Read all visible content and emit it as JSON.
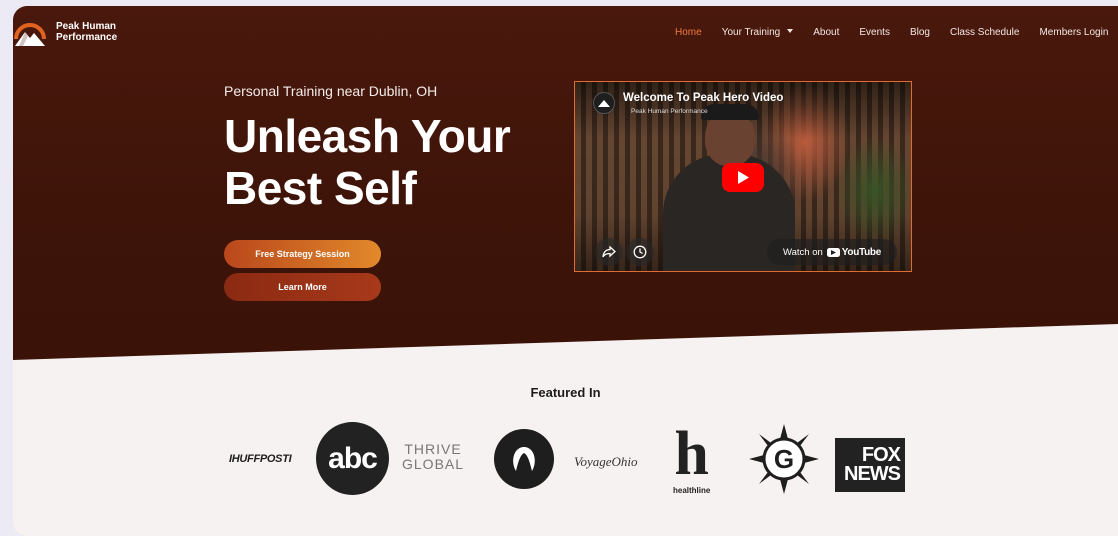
{
  "brand": {
    "name_line1": "Peak Human",
    "name_line2": "Performance",
    "accent": "#e2631f"
  },
  "nav": {
    "items": [
      {
        "label": "Home",
        "active": true
      },
      {
        "label": "Your Training",
        "dropdown": true
      },
      {
        "label": "About"
      },
      {
        "label": "Events"
      },
      {
        "label": "Blog"
      },
      {
        "label": "Class Schedule"
      },
      {
        "label": "Members Login"
      }
    ]
  },
  "hero": {
    "kicker": "Personal Training near Dublin, OH",
    "headline_line1": "Unleash Your",
    "headline_line2": "Best Self",
    "primary_cta": "Free Strategy Session",
    "secondary_cta": "Learn More"
  },
  "video": {
    "title": "Welcome To Peak Hero Video",
    "channel": "Peak Human Performance",
    "watch_on": "Watch on",
    "platform": "YouTube"
  },
  "featured": {
    "heading": "Featured In",
    "logos": {
      "huffpost": "IHUFFPOSTI",
      "abc": "abc",
      "thrive_line1": "THRIVE",
      "thrive_line2": "GLOBAL",
      "voyage": "VoyageOhio",
      "healthline_mark": "h",
      "healthline": "healthline",
      "g": "G",
      "fox_line1": "FOX",
      "fox_line2": "NEWS"
    }
  }
}
